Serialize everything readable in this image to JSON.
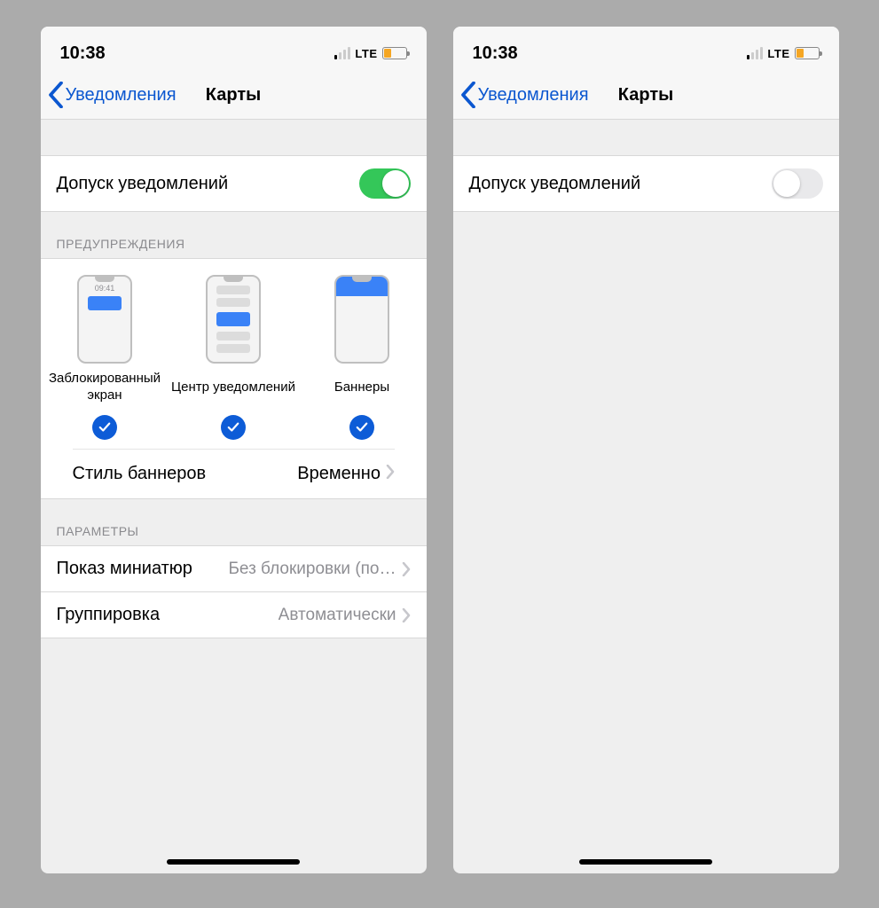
{
  "status": {
    "time": "10:38",
    "lte": "LTE"
  },
  "nav": {
    "back": "Уведомления",
    "title": "Карты"
  },
  "left": {
    "allow_label": "Допуск уведомлений",
    "alerts_header": "ПРЕДУПРЕЖДЕНИЯ",
    "alerts": {
      "lock": "Заблокированный экран",
      "center": "Центр уведомлений",
      "banners": "Баннеры",
      "lock_time": "09:41"
    },
    "banner_style": {
      "label": "Стиль баннеров",
      "value": "Временно"
    },
    "options_header": "ПАРАМЕТРЫ",
    "previews": {
      "label": "Показ миниатюр",
      "value": "Без блокировки (по…"
    },
    "grouping": {
      "label": "Группировка",
      "value": "Автоматически"
    }
  },
  "right": {
    "allow_label": "Допуск уведомлений"
  }
}
